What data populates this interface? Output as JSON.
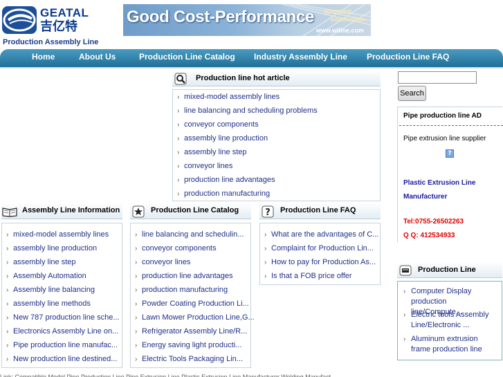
{
  "logo": {
    "brand_en": "GEATAL",
    "brand_cn": "吉亿特"
  },
  "site_name": "Production Assembly Line",
  "banner": {
    "text": "Good Cost-Performance",
    "url": "www.wlline.com"
  },
  "nav": [
    "Home",
    "About Us",
    "Production Line Catalog",
    "Industry Assembly Line",
    "Production Line FAQ"
  ],
  "hot_article": {
    "title": "Production line hot article",
    "items": [
      "mixed-model assembly lines",
      "line balancing and scheduling problems",
      "conveyor components",
      "assembly line production",
      "assembly line step",
      "conveyor lines",
      "production line advantages",
      "production manufacturing"
    ]
  },
  "info_panel": {
    "title": "Assembly Line Information",
    "items": [
      "mixed-model assembly lines",
      "assembly line production",
      "assembly line step",
      "Assembly Automation",
      "Assembly line balancing",
      "assembly line methods",
      "New 787 production line sche...",
      "Electronics Assembly Line on...",
      "Pipe production line manufac...",
      "New production line destined..."
    ]
  },
  "catalog_panel": {
    "title": "Production Line Catalog",
    "items": [
      "line balancing and schedulin...",
      "conveyor components",
      "conveyor lines",
      "production line advantages",
      "production manufacturing",
      "Powder Coating Production Li...",
      "Lawn Mower Production Line,G...",
      "Refrigerator Assembly Line/R...",
      "Energy saving light producti...",
      "Electric Tools Packaging Lin..."
    ]
  },
  "faq_panel": {
    "title": "Production Line FAQ",
    "items": [
      "What are the advantages of C...",
      "Complaint for Production Lin...",
      "How to pay for Production As...",
      "Is that a FOB price offer"
    ]
  },
  "search": {
    "placeholder": "",
    "value": "",
    "button": "Search"
  },
  "ad": {
    "title": "Pipe production line AD",
    "line1": "Pipe extrusion line supplier",
    "image_icon": "?",
    "line2": "Plastic Extrusion Line Manufacturer",
    "tel": "Tel:0755-26502263",
    "qq": "Q Q: 412534933"
  },
  "production_line_panel": {
    "title": "Production Line",
    "items": [
      "Computer Display production line/Compute...",
      "Electric tools Assembly Line/Electronic ...",
      "Aluminum extrusion frame production line"
    ]
  },
  "footer": "Link: Compatible Model Pipe Production Line Pipe Extrusion Line Plastic Extrusion Line Manufacturer Welding Manufact",
  "colors": {
    "nav_bg": "#1f6f98",
    "link": "#1f2f88",
    "ad_red": "#e00000"
  }
}
